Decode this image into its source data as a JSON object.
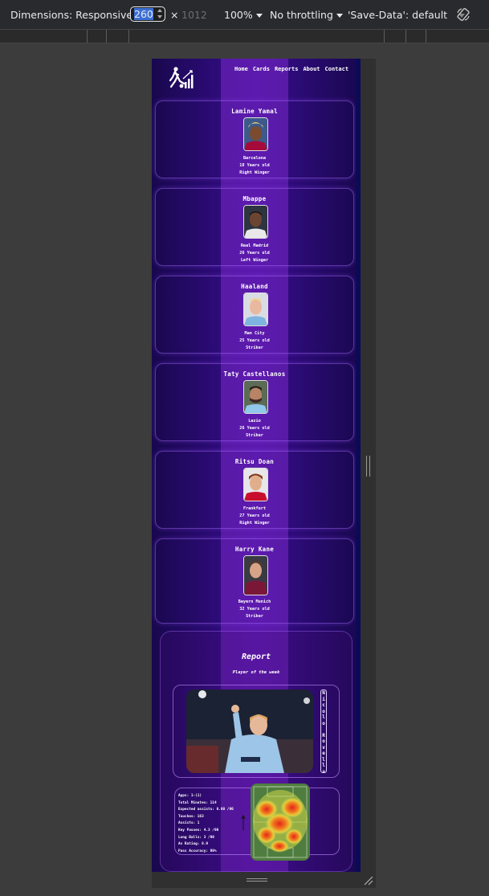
{
  "devtools": {
    "dimensions_label": "Dimensions: Responsive",
    "width_value": "260",
    "times": "×",
    "height_value": "1012",
    "zoom": "100%",
    "throttling": "No throttling",
    "save_data": "'Save-Data': default"
  },
  "nav": {
    "links": [
      "Home",
      "Cards",
      "Reports",
      "About",
      "Contact"
    ]
  },
  "players": [
    {
      "name": "Lamine Yamal",
      "club": "Barcelona",
      "age": "18 Years old",
      "position": "Right Winger"
    },
    {
      "name": "Mbappe",
      "club": "Real Madrid",
      "age": "26 Years old",
      "position": "Left Winger"
    },
    {
      "name": "Haaland",
      "club": "Man City",
      "age": "25 Years old",
      "position": "Striker"
    },
    {
      "name": "Taty Castellanos",
      "club": "Lazio",
      "age": "26 Years old",
      "position": "Striker"
    },
    {
      "name": "Ritsu Doan",
      "club": "Frankfurt",
      "age": "27 Years old",
      "position": "Right Winger"
    },
    {
      "name": "Harry Kane",
      "club": "Bayern Munich",
      "age": "32 Years old",
      "position": "Striker"
    }
  ],
  "report": {
    "title": "Report",
    "subtitle": "Player of the week",
    "potw_name": "Nicolo Rovella",
    "stats": [
      "Apps: 1-(1)",
      "Total Minutes: 114",
      "Expected assists: 0.80 /90",
      "Touches: 163",
      "Assists: 1",
      "Key Passes: 4.3 /90",
      "Long Balls: 3 /90",
      "Av Rating: 8.9",
      "Pass Accuracy: 90%"
    ]
  },
  "colors": {
    "page_bg": "#2c0b76",
    "accent": "#8a4dff"
  }
}
